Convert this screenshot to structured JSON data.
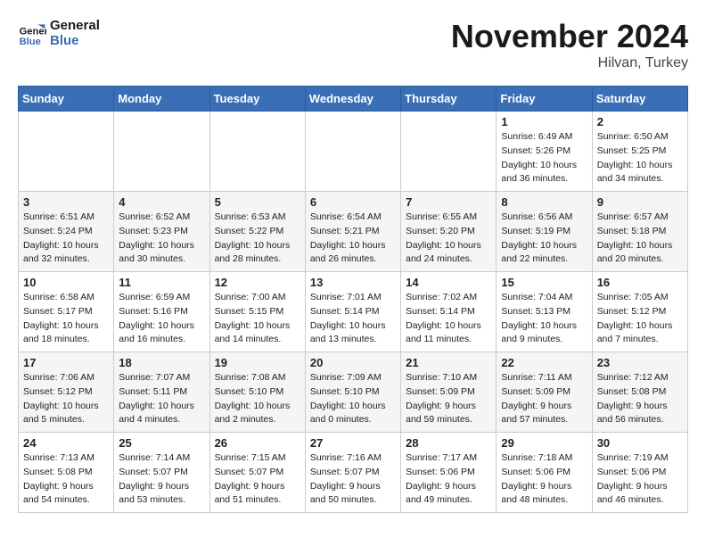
{
  "logo": {
    "line1": "General",
    "line2": "Blue"
  },
  "title": "November 2024",
  "location": "Hilvan, Turkey",
  "days_header": [
    "Sunday",
    "Monday",
    "Tuesday",
    "Wednesday",
    "Thursday",
    "Friday",
    "Saturday"
  ],
  "weeks": [
    [
      {
        "num": "",
        "info": ""
      },
      {
        "num": "",
        "info": ""
      },
      {
        "num": "",
        "info": ""
      },
      {
        "num": "",
        "info": ""
      },
      {
        "num": "",
        "info": ""
      },
      {
        "num": "1",
        "info": "Sunrise: 6:49 AM\nSunset: 5:26 PM\nDaylight: 10 hours\nand 36 minutes."
      },
      {
        "num": "2",
        "info": "Sunrise: 6:50 AM\nSunset: 5:25 PM\nDaylight: 10 hours\nand 34 minutes."
      }
    ],
    [
      {
        "num": "3",
        "info": "Sunrise: 6:51 AM\nSunset: 5:24 PM\nDaylight: 10 hours\nand 32 minutes."
      },
      {
        "num": "4",
        "info": "Sunrise: 6:52 AM\nSunset: 5:23 PM\nDaylight: 10 hours\nand 30 minutes."
      },
      {
        "num": "5",
        "info": "Sunrise: 6:53 AM\nSunset: 5:22 PM\nDaylight: 10 hours\nand 28 minutes."
      },
      {
        "num": "6",
        "info": "Sunrise: 6:54 AM\nSunset: 5:21 PM\nDaylight: 10 hours\nand 26 minutes."
      },
      {
        "num": "7",
        "info": "Sunrise: 6:55 AM\nSunset: 5:20 PM\nDaylight: 10 hours\nand 24 minutes."
      },
      {
        "num": "8",
        "info": "Sunrise: 6:56 AM\nSunset: 5:19 PM\nDaylight: 10 hours\nand 22 minutes."
      },
      {
        "num": "9",
        "info": "Sunrise: 6:57 AM\nSunset: 5:18 PM\nDaylight: 10 hours\nand 20 minutes."
      }
    ],
    [
      {
        "num": "10",
        "info": "Sunrise: 6:58 AM\nSunset: 5:17 PM\nDaylight: 10 hours\nand 18 minutes."
      },
      {
        "num": "11",
        "info": "Sunrise: 6:59 AM\nSunset: 5:16 PM\nDaylight: 10 hours\nand 16 minutes."
      },
      {
        "num": "12",
        "info": "Sunrise: 7:00 AM\nSunset: 5:15 PM\nDaylight: 10 hours\nand 14 minutes."
      },
      {
        "num": "13",
        "info": "Sunrise: 7:01 AM\nSunset: 5:14 PM\nDaylight: 10 hours\nand 13 minutes."
      },
      {
        "num": "14",
        "info": "Sunrise: 7:02 AM\nSunset: 5:14 PM\nDaylight: 10 hours\nand 11 minutes."
      },
      {
        "num": "15",
        "info": "Sunrise: 7:04 AM\nSunset: 5:13 PM\nDaylight: 10 hours\nand 9 minutes."
      },
      {
        "num": "16",
        "info": "Sunrise: 7:05 AM\nSunset: 5:12 PM\nDaylight: 10 hours\nand 7 minutes."
      }
    ],
    [
      {
        "num": "17",
        "info": "Sunrise: 7:06 AM\nSunset: 5:12 PM\nDaylight: 10 hours\nand 5 minutes."
      },
      {
        "num": "18",
        "info": "Sunrise: 7:07 AM\nSunset: 5:11 PM\nDaylight: 10 hours\nand 4 minutes."
      },
      {
        "num": "19",
        "info": "Sunrise: 7:08 AM\nSunset: 5:10 PM\nDaylight: 10 hours\nand 2 minutes."
      },
      {
        "num": "20",
        "info": "Sunrise: 7:09 AM\nSunset: 5:10 PM\nDaylight: 10 hours\nand 0 minutes."
      },
      {
        "num": "21",
        "info": "Sunrise: 7:10 AM\nSunset: 5:09 PM\nDaylight: 9 hours\nand 59 minutes."
      },
      {
        "num": "22",
        "info": "Sunrise: 7:11 AM\nSunset: 5:09 PM\nDaylight: 9 hours\nand 57 minutes."
      },
      {
        "num": "23",
        "info": "Sunrise: 7:12 AM\nSunset: 5:08 PM\nDaylight: 9 hours\nand 56 minutes."
      }
    ],
    [
      {
        "num": "24",
        "info": "Sunrise: 7:13 AM\nSunset: 5:08 PM\nDaylight: 9 hours\nand 54 minutes."
      },
      {
        "num": "25",
        "info": "Sunrise: 7:14 AM\nSunset: 5:07 PM\nDaylight: 9 hours\nand 53 minutes."
      },
      {
        "num": "26",
        "info": "Sunrise: 7:15 AM\nSunset: 5:07 PM\nDaylight: 9 hours\nand 51 minutes."
      },
      {
        "num": "27",
        "info": "Sunrise: 7:16 AM\nSunset: 5:07 PM\nDaylight: 9 hours\nand 50 minutes."
      },
      {
        "num": "28",
        "info": "Sunrise: 7:17 AM\nSunset: 5:06 PM\nDaylight: 9 hours\nand 49 minutes."
      },
      {
        "num": "29",
        "info": "Sunrise: 7:18 AM\nSunset: 5:06 PM\nDaylight: 9 hours\nand 48 minutes."
      },
      {
        "num": "30",
        "info": "Sunrise: 7:19 AM\nSunset: 5:06 PM\nDaylight: 9 hours\nand 46 minutes."
      }
    ]
  ]
}
